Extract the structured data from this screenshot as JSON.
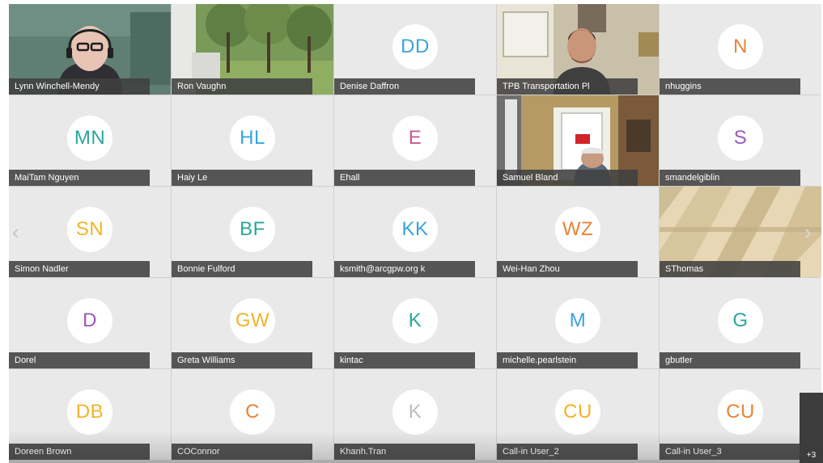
{
  "participants": [
    {
      "name": "Lynn Winchell-Mendy",
      "type": "video",
      "scene": "woman-headset"
    },
    {
      "name": "Ron Vaughn",
      "type": "video",
      "scene": "trees-window"
    },
    {
      "name": "Denise Daffron",
      "initials": "DD",
      "color": "#3aa3dd",
      "type": "avatar"
    },
    {
      "name": "TPB Transportation Pl",
      "type": "video",
      "scene": "man-room"
    },
    {
      "name": "nhuggins",
      "initials": "N",
      "color": "#e8833a",
      "type": "avatar"
    },
    {
      "name": "MaiTam Nguyen",
      "initials": "MN",
      "color": "#2ba69a",
      "type": "avatar"
    },
    {
      "name": "Haiy Le",
      "initials": "HL",
      "color": "#3aa3dd",
      "type": "avatar"
    },
    {
      "name": "Ehall",
      "initials": "E",
      "color": "#c25b95",
      "type": "avatar"
    },
    {
      "name": "Samuel Bland",
      "type": "video",
      "scene": "man-door"
    },
    {
      "name": "smandelgiblin",
      "initials": "S",
      "color": "#9b59b6",
      "type": "avatar"
    },
    {
      "name": "Simon Nadler",
      "initials": "SN",
      "color": "#f0b429",
      "type": "avatar"
    },
    {
      "name": "Bonnie Fulford",
      "initials": "BF",
      "color": "#2ba69a",
      "type": "avatar"
    },
    {
      "name": "ksmith@arcgpw.org k",
      "initials": "KK",
      "color": "#3aa3dd",
      "type": "avatar"
    },
    {
      "name": "Wei-Han Zhou",
      "initials": "WZ",
      "color": "#e8833a",
      "type": "avatar"
    },
    {
      "name": "SThomas",
      "type": "video",
      "scene": "shadows-wall"
    },
    {
      "name": "Dorel",
      "initials": "D",
      "color": "#9b59b6",
      "type": "avatar"
    },
    {
      "name": "Greta Williams",
      "initials": "GW",
      "color": "#f0b429",
      "type": "avatar"
    },
    {
      "name": "kintac",
      "initials": "K",
      "color": "#2ba69a",
      "type": "avatar"
    },
    {
      "name": "michelle.pearlstein",
      "initials": "M",
      "color": "#3aa3dd",
      "type": "avatar"
    },
    {
      "name": "gbutler",
      "initials": "G",
      "color": "#2ba69a",
      "type": "avatar"
    },
    {
      "name": "Doreen Brown",
      "initials": "DB",
      "color": "#f0b429",
      "type": "avatar"
    },
    {
      "name": "COConnor",
      "initials": "C",
      "color": "#e8833a",
      "type": "avatar"
    },
    {
      "name": "Khanh.Tran",
      "initials": "K",
      "color": "#bdbdbd",
      "type": "avatar"
    },
    {
      "name": "Call-in User_2",
      "initials": "CU",
      "color": "#f0b429",
      "type": "avatar"
    },
    {
      "name": "Call-in User_3",
      "initials": "CU",
      "color": "#e8833a",
      "type": "avatar"
    }
  ],
  "navigation": {
    "prev_icon": "chevron-left-icon",
    "next_icon": "chevron-right-icon",
    "prev_glyph": "‹",
    "next_glyph": "›"
  },
  "overflow": {
    "label": "+3"
  }
}
